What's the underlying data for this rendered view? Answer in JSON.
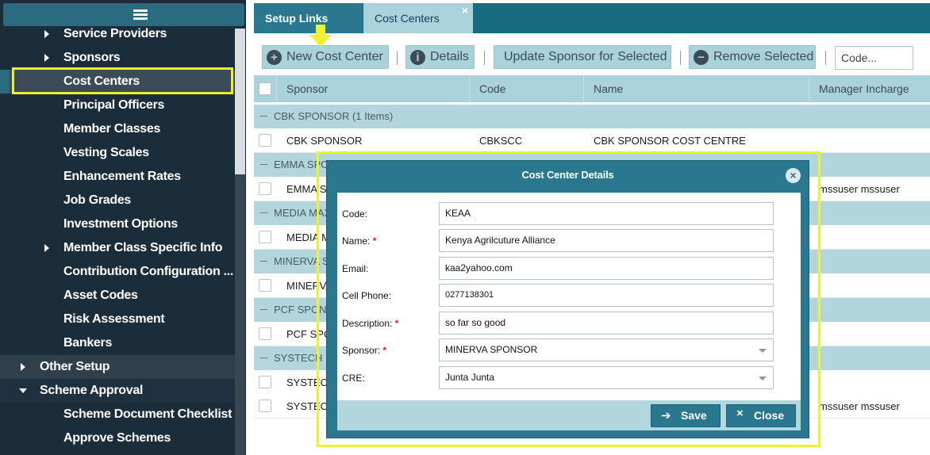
{
  "sidebar": {
    "items": [
      {
        "label": "Service Providers",
        "expandable": true
      },
      {
        "label": "Sponsors",
        "expandable": true
      },
      {
        "label": "Cost Centers",
        "selected": true
      },
      {
        "label": "Principal Officers"
      },
      {
        "label": "Member Classes"
      },
      {
        "label": "Vesting Scales"
      },
      {
        "label": "Enhancement Rates"
      },
      {
        "label": "Job Grades"
      },
      {
        "label": "Investment Options"
      },
      {
        "label": "Member Class Specific Info",
        "expandable": true
      },
      {
        "label": "Contribution Configuration ..."
      },
      {
        "label": "Asset Codes"
      },
      {
        "label": "Risk Assessment"
      },
      {
        "label": "Bankers"
      },
      {
        "label": "Other Setup",
        "top_level": true,
        "collapsed": true
      },
      {
        "label": "Scheme Approval",
        "top_level": true,
        "expanded": true
      },
      {
        "label": "Scheme Document Checklist"
      },
      {
        "label": "Approve Schemes"
      }
    ]
  },
  "tabs": {
    "setup_links": "Setup Links",
    "cost_centers": "Cost Centers",
    "close_glyph": "×"
  },
  "toolbar": {
    "new_cost_center": "New Cost Center",
    "details": "Details",
    "update_sponsor": "Update Sponsor for Selected",
    "remove_selected": "Remove Selected",
    "code_placeholder": "Code..."
  },
  "grid": {
    "columns": [
      "Sponsor",
      "Code",
      "Name",
      "Manager Incharge"
    ],
    "groups": [
      {
        "title": "CBK SPONSOR (1 Items)",
        "rows": [
          {
            "sponsor": "CBK SPONSOR",
            "code": "CBKSCC",
            "name": "CBK SPONSOR COST CENTRE",
            "manager": ""
          }
        ]
      },
      {
        "title": "EMMA SPON",
        "rows": [
          {
            "sponsor": "EMMA SP",
            "code": "",
            "name": "",
            "manager": "mssuser mssuser"
          }
        ]
      },
      {
        "title": "MEDIA MAX",
        "rows": [
          {
            "sponsor": "MEDIA M",
            "code": "",
            "name": "",
            "manager": ""
          }
        ]
      },
      {
        "title": "MINERVA SP",
        "rows": [
          {
            "sponsor": "MINERVA",
            "code": "",
            "name": "",
            "manager": ""
          }
        ]
      },
      {
        "title": "PCF SPONS",
        "rows": [
          {
            "sponsor": "PCF SPON",
            "code": "",
            "name": "",
            "manager": ""
          }
        ]
      },
      {
        "title": "SYSTECH DE",
        "rows": [
          {
            "sponsor": "SYSTECH",
            "code": "",
            "name": "",
            "manager": ""
          },
          {
            "sponsor": "SYSTECH",
            "code": "",
            "name": "",
            "manager": "mssuser mssuser"
          }
        ]
      }
    ]
  },
  "modal": {
    "title": "Cost Center Details",
    "fields": [
      {
        "label": "Code:",
        "required": false,
        "value": "KEAA"
      },
      {
        "label": "Name:",
        "required": true,
        "value": "Kenya Agrilcuture Alliance"
      },
      {
        "label": "Email:",
        "required": false,
        "value": "kaa2yahoo.com"
      },
      {
        "label": "Cell Phone:",
        "required": false,
        "value": "0277138301"
      },
      {
        "label": "Description:",
        "required": true,
        "value": "so far so good"
      },
      {
        "label": "Sponsor:",
        "required": true,
        "value": "MINERVA SPONSOR",
        "select": true
      },
      {
        "label": "CRE:",
        "required": false,
        "value": "Junta Junta",
        "select": true
      }
    ],
    "required_mark": "*",
    "save": "Save",
    "close": "Close"
  },
  "colors": {
    "sidebar_bg": "#1b2d3b",
    "accent_teal": "#2a7890",
    "light_teal": "#a9d2db",
    "highlight_yellow": "#ecf22c",
    "required_red": "#dd2222"
  }
}
